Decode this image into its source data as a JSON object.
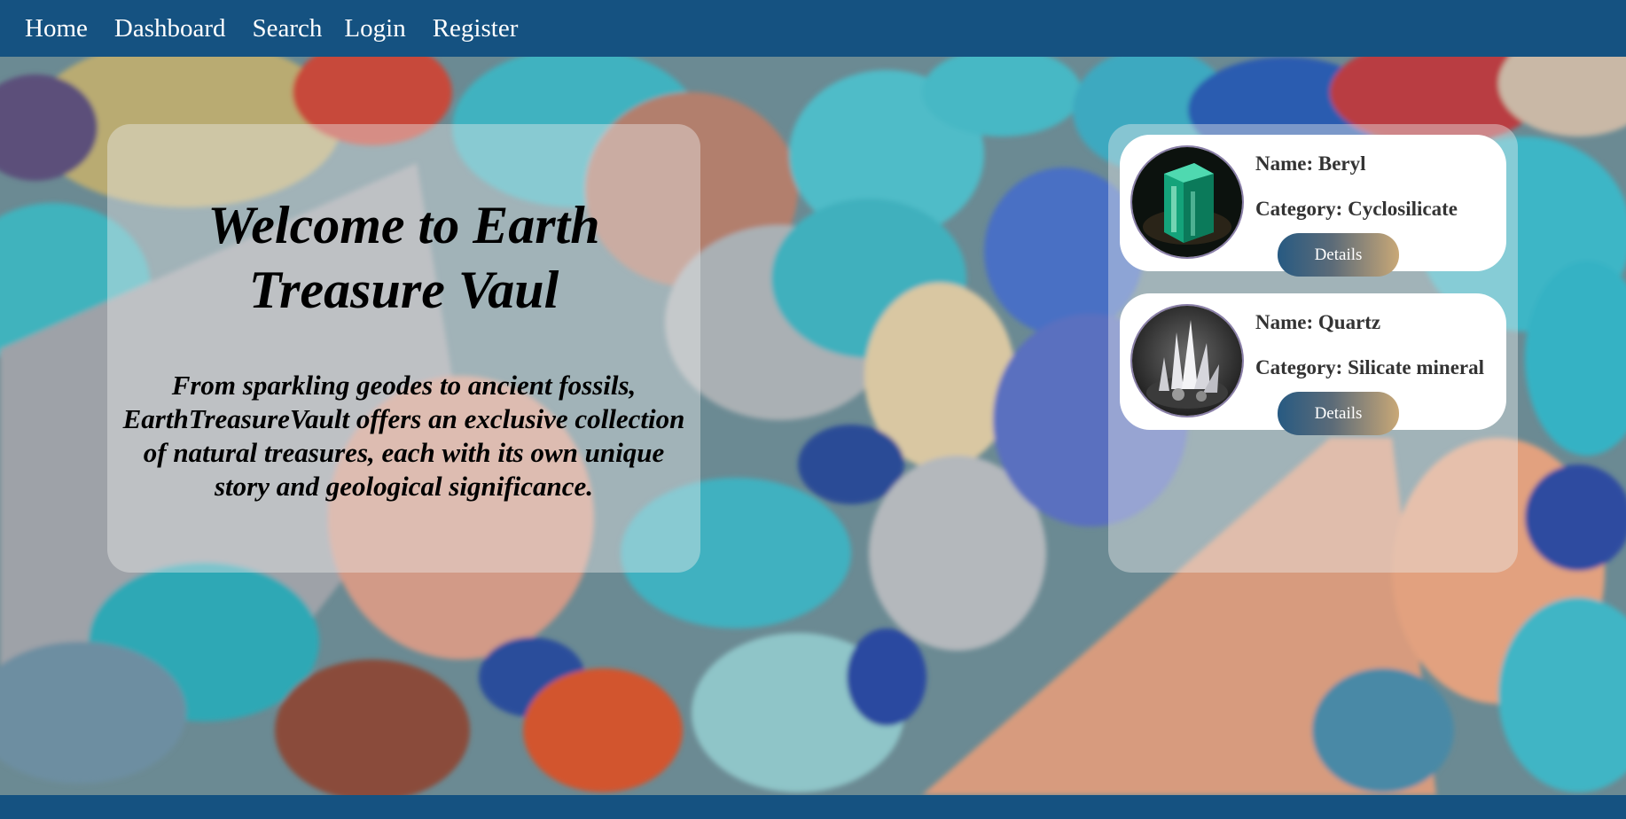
{
  "nav": {
    "home": "Home",
    "dashboard": "Dashboard",
    "search": "Search",
    "login": "Login",
    "register": "Register"
  },
  "welcome": {
    "title": "Welcome to Earth Treasure Vaul",
    "text": "From sparkling geodes to ancient fossils, EarthTreasureVault offers an exclusive collection of natural treasures, each with its own unique story and geological significance."
  },
  "cards": [
    {
      "name": "Name: Beryl",
      "category": "Category: Cyclosilicate",
      "button": "Details",
      "image_icon": "emerald-crystal-image"
    },
    {
      "name": "Name: Quartz",
      "category": "Category: Silicate mineral",
      "button": "Details",
      "image_icon": "quartz-crystal-image"
    }
  ],
  "colors": {
    "navbar": "#155281",
    "button_gradient_start": "#275a82",
    "button_gradient_end": "#c9a877"
  }
}
